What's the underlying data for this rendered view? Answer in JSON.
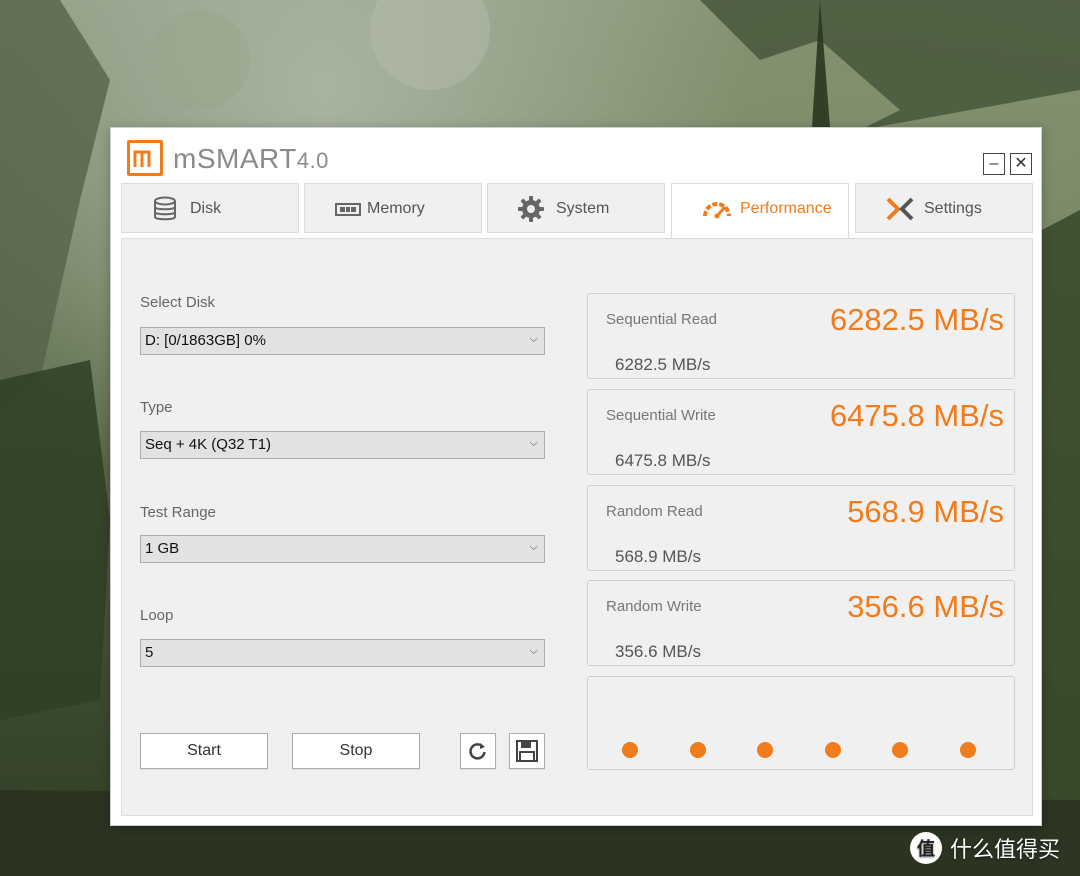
{
  "app": {
    "name": "mSMART",
    "version": "4.0",
    "accent_color": "#f07c1c",
    "window_controls": {
      "minimize": "–",
      "close": "✕"
    }
  },
  "tabs": [
    {
      "label": "Disk",
      "icon": "database-icon",
      "active": false
    },
    {
      "label": "Memory",
      "icon": "memory-chip-icon",
      "active": false
    },
    {
      "label": "System",
      "icon": "gear-icon",
      "active": false
    },
    {
      "label": "Performance",
      "icon": "speedometer-icon",
      "active": true
    },
    {
      "label": "Settings",
      "icon": "x-logo-icon",
      "active": false
    }
  ],
  "form": {
    "select_disk": {
      "label": "Select Disk",
      "value": "D: [0/1863GB] 0%"
    },
    "type": {
      "label": "Type",
      "value": "Seq + 4K (Q32 T1)"
    },
    "test_range": {
      "label": "Test Range",
      "value": "1 GB"
    },
    "loop": {
      "label": "Loop",
      "value": "5"
    }
  },
  "buttons": {
    "start": "Start",
    "stop": "Stop",
    "refresh_icon": "refresh-icon",
    "save_icon": "floppy-disk-icon"
  },
  "results": [
    {
      "label": "Sequential Read",
      "big": "6282.5 MB/s",
      "small": "6282.5 MB/s"
    },
    {
      "label": "Sequential Write",
      "big": "6475.8 MB/s",
      "small": "6475.8 MB/s"
    },
    {
      "label": "Random Read",
      "big": "568.9 MB/s",
      "small": "568.9 MB/s"
    },
    {
      "label": "Random Write",
      "big": "356.6 MB/s",
      "small": "356.6 MB/s"
    }
  ],
  "progress_dots": 6,
  "watermark": {
    "logo": "值",
    "text": "什么值得买"
  }
}
